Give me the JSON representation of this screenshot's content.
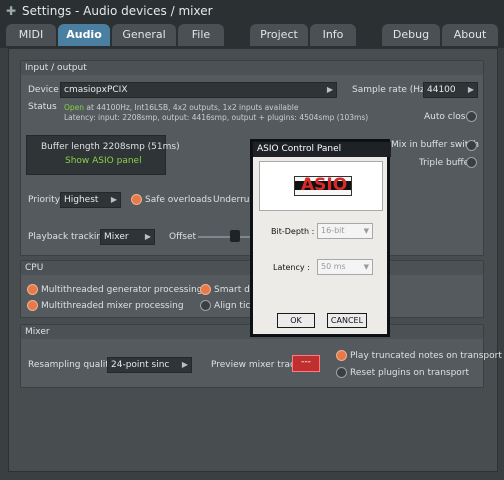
{
  "window": {
    "title": "Settings - Audio devices / mixer"
  },
  "tabs": [
    {
      "label": "MIDI"
    },
    {
      "label": "Audio"
    },
    {
      "label": "General"
    },
    {
      "label": "File"
    },
    {
      "label": "Project"
    },
    {
      "label": "Info"
    },
    {
      "label": "Debug"
    },
    {
      "label": "About"
    }
  ],
  "io": {
    "header": "Input / output",
    "device_label": "Device",
    "device_value": "cmasiopxPCIX",
    "sample_rate_label": "Sample rate (Hz)",
    "sample_rate_value": "44100",
    "status_label": "Status",
    "status_open": "Open",
    "status_line1": " at 44100Hz, Int16LSB, 4x2 outputs, 1x2 inputs available",
    "status_line2": "Latency: input: 2208smp, output: 4416smp, output + plugins: 4504smp (103ms)",
    "auto_close": "Auto close",
    "buffer_length": "Buffer length 2208smp (51ms)",
    "show_asio": "Show ASIO panel",
    "mix_in_buffer": "Mix in buffer switch",
    "triple_buffer": "Triple buffer",
    "priority_label": "Priority",
    "priority_value": "Highest",
    "safe_overloads": "Safe overloads",
    "underruns": "Underruns",
    "playback_tracking_label": "Playback tracking",
    "playback_tracking_value": "Mixer",
    "offset_label": "Offset"
  },
  "cpu": {
    "header": "CPU",
    "multi_gen": "Multithreaded generator processing",
    "multi_mix": "Multithreaded mixer processing",
    "smart_dis": "Smart disa",
    "align_tick": "Align tick l"
  },
  "mixer": {
    "header": "Mixer",
    "resampling_label": "Resampling quality",
    "resampling_value": "24-point sinc",
    "preview_label": "Preview mixer track",
    "preview_value": "---",
    "play_truncated": "Play truncated notes on transport",
    "reset_plugins": "Reset plugins on transport"
  },
  "dialog": {
    "title": "ASIO Control Panel",
    "logo_text": "ASIO",
    "bit_depth_label": "Bit-Depth :",
    "bit_depth_value": "16-bit",
    "latency_label": "Latency :",
    "latency_value": "50 ms",
    "ok": "OK",
    "cancel": "CANCEL"
  },
  "colors": {
    "accent": "#4b7fa1",
    "radio_on": "#e87a4a",
    "status_green": "#86d24a"
  }
}
